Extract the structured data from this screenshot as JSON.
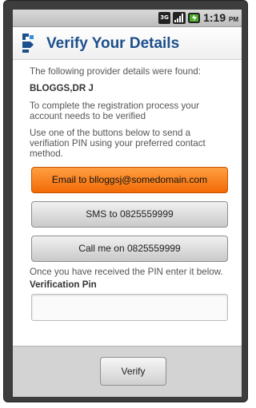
{
  "status_bar": {
    "network": "3G",
    "time": "1:19",
    "ampm": "PM"
  },
  "header": {
    "title": "Verify Your Details"
  },
  "content": {
    "intro": "The following provider details were found:",
    "provider_name": "BLOGGS,DR J",
    "verify_message": "To complete the registration process your account needs to be verified",
    "instructions": "Use one of the buttons below to send a verifiation PIN using your preferred contact method.",
    "email_button": "Email to blloggsj@somedomain.com",
    "sms_button": "SMS to 0825559999",
    "call_button": "Call me on 0825559999",
    "after_pin_text": "Once you have received the PIN enter it below.",
    "pin_label": "Verification Pin",
    "pin_value": "",
    "pin_placeholder": ""
  },
  "footer": {
    "verify_label": "Verify"
  },
  "colors": {
    "accent": "#f26a05",
    "title": "#1d4f8c"
  }
}
